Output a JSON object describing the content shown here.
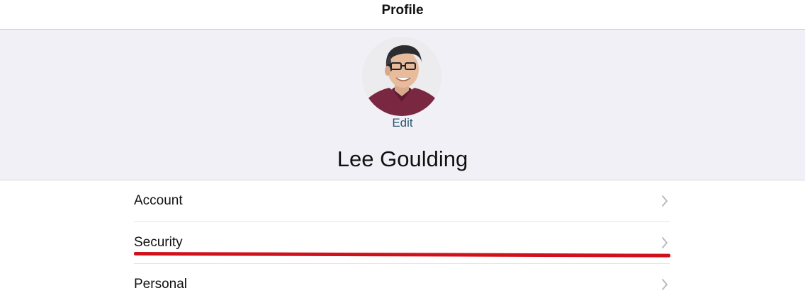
{
  "nav": {
    "title": "Profile"
  },
  "profile": {
    "avatar_alt": "profile photo",
    "edit_label": "Edit",
    "name": "Lee Goulding"
  },
  "menu": {
    "items": [
      {
        "label": "Account",
        "icon": "chevron-right-icon"
      },
      {
        "label": "Security",
        "icon": "chevron-right-icon"
      },
      {
        "label": "Personal",
        "icon": "chevron-right-icon"
      }
    ]
  },
  "colors": {
    "header_background": "#f1f0f6",
    "edit_link": "#2e5a73",
    "highlight_underline": "#d0111b",
    "chevron": "#b6b6bb"
  }
}
